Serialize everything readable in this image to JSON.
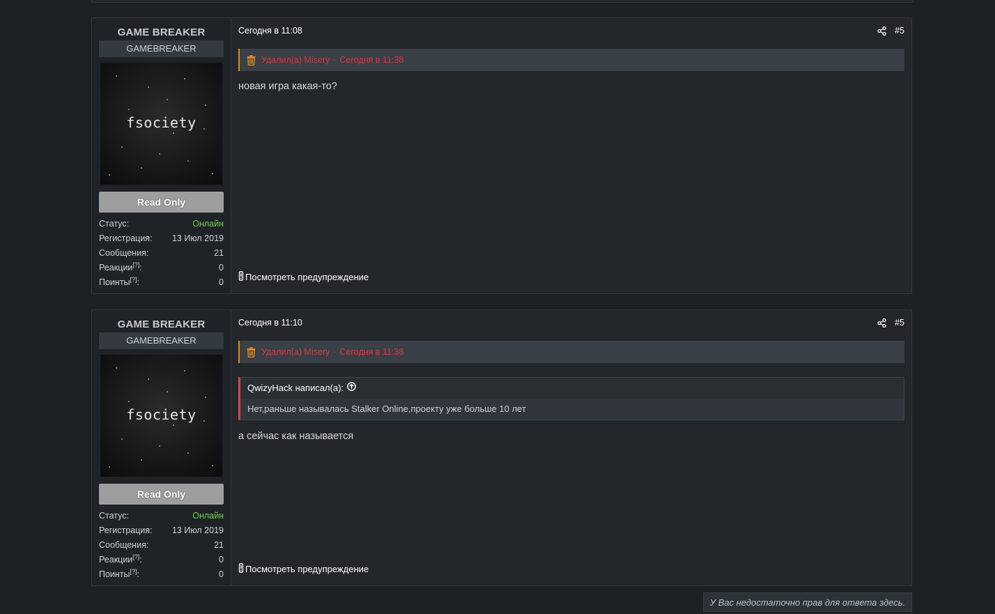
{
  "posts": [
    {
      "author": {
        "name": "GAME BREAKER",
        "title": "GAMEBREAKER",
        "avatar_text": "fsociety",
        "banner": "Read Only",
        "stats": [
          {
            "label": "Статус:",
            "value": "Онлайн"
          },
          {
            "label": "Регистрация:",
            "value": "13 Июл 2019"
          },
          {
            "label": "Сообщения:",
            "value": "21"
          },
          {
            "label": "Реакции",
            "sup": "[?]",
            "suffix": ":",
            "value": "0"
          },
          {
            "label": "Поинты",
            "sup": "[?]",
            "suffix": ":",
            "value": "0"
          }
        ]
      },
      "time": "Сегодня в 11:08",
      "number": "#5",
      "deleted": {
        "by": "Удалил(а) Misery",
        "sep": "·",
        "time": "Сегодня в 11:38"
      },
      "text": "новая игра какая-то?",
      "warning_link": "Посмотреть предупреждение"
    },
    {
      "author": {
        "name": "GAME BREAKER",
        "title": "GAMEBREAKER",
        "avatar_text": "fsociety",
        "banner": "Read Only",
        "stats": [
          {
            "label": "Статус:",
            "value": "Онлайн"
          },
          {
            "label": "Регистрация:",
            "value": "13 Июл 2019"
          },
          {
            "label": "Сообщения:",
            "value": "21"
          },
          {
            "label": "Реакции",
            "sup": "[?]",
            "suffix": ":",
            "value": "0"
          },
          {
            "label": "Поинты",
            "sup": "[?]",
            "suffix": ":",
            "value": "0"
          }
        ]
      },
      "time": "Сегодня в 11:10",
      "number": "#5",
      "deleted": {
        "by": "Удалил(а) Misery",
        "sep": "·",
        "time": "Сегодня в 11:38"
      },
      "quote": {
        "header": "QwizyHack написал(а):",
        "body": "Нет,раньше называлась Stalker Online,проекту уже больше 10 лет"
      },
      "text": "а сейчас как называется",
      "warning_link": "Посмотреть предупреждение"
    }
  ],
  "no_reply_notice": "У Вас недостаточно прав для ответа здесь.",
  "colors": {
    "background": "#1d2024",
    "post_bg": "#23272b",
    "online": "#6fd24b",
    "deleted_text": "#d9383a",
    "deleted_accent": "#e08a1e",
    "quote_accent": "#d14a4a"
  },
  "icons": [
    "share-icon",
    "trash-icon",
    "arrow-up-circle-icon",
    "exclamation-icon"
  ]
}
